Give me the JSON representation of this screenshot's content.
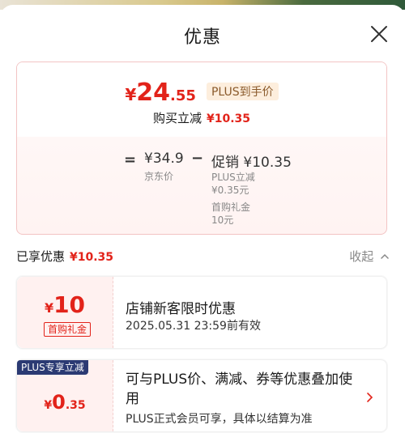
{
  "header": {
    "title": "优惠"
  },
  "price_card": {
    "currency": "¥",
    "price_int": "24",
    "price_dec": ".55",
    "plus_tag": "PLUS到手价",
    "reduce_label": "购买立减",
    "reduce_amount": "¥10.35",
    "equals": "=",
    "jd_price": "¥34.9",
    "jd_label": "京东价",
    "minus": "−",
    "promo": "促销 ¥10.35",
    "promo_items": [
      {
        "name": "PLUS立减",
        "value": "¥0.35元"
      },
      {
        "name": "首购礼金",
        "value": "10元"
      }
    ]
  },
  "summary": {
    "enjoyed_label": "已享优惠",
    "enjoyed_amount": "¥10.35",
    "collapse_label": "收起"
  },
  "coupons": [
    {
      "currency": "¥",
      "amount": "10",
      "tag": "首购礼金",
      "title": "店铺新客限时优惠",
      "subtitle": "2025.05.31 23:59前有效"
    },
    {
      "badge": "PLUS专享立减",
      "currency": "¥",
      "amount_int": "0",
      "amount_dec": ".35",
      "title": "可与PLUS价、满减、券等优惠叠加使用",
      "subtitle": "PLUS正式会员可享，具体以结算为准"
    }
  ],
  "colors": {
    "accent_red": "#e2231a",
    "plus_badge": "#2b3a73",
    "plus_tag_bg": "#fdeedd"
  }
}
